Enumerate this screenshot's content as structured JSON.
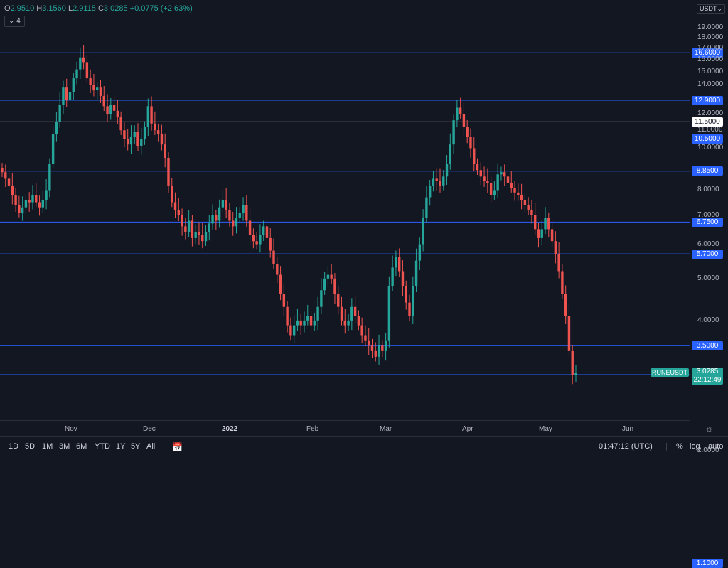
{
  "header": {
    "ohlc_o_label": "O",
    "ohlc_o": "2.9510",
    "ohlc_h_label": "H",
    "ohlc_h": "3.1560",
    "ohlc_l_label": "L",
    "ohlc_l": "2.9115",
    "ohlc_c_label": "C",
    "ohlc_c": "3.0285",
    "ohlc_change": "+0.0775 (+2.63%)",
    "indicator_count": "4",
    "currency": "USDT"
  },
  "price_axis": {
    "ticks": [
      "19.0000",
      "18.0000",
      "17.0000",
      "16.0000",
      "15.0000",
      "14.0000",
      "12.0000",
      "11.0000",
      "10.0000",
      "8.0000",
      "7.0000",
      "6.0000",
      "5.0000",
      "4.0000",
      "2.0000"
    ]
  },
  "levels": [
    {
      "label": "16.6000",
      "value": 16.6
    },
    {
      "label": "12.9000",
      "value": 12.9
    },
    {
      "label": "11.5000",
      "value": 11.5,
      "white": true
    },
    {
      "label": "10.5000",
      "value": 10.5
    },
    {
      "label": "8.8500",
      "value": 8.85
    },
    {
      "label": "6.7500",
      "value": 6.75
    },
    {
      "label": "5.7000",
      "value": 5.7
    },
    {
      "label": "3.5000",
      "value": 3.5
    },
    {
      "label": "3.0000",
      "value": 3.0
    },
    {
      "label": "1.1000",
      "value": 1.1
    }
  ],
  "current": {
    "symbol": "RUNEUSDT",
    "price": "3.0285",
    "countdown": "22:12:49",
    "value": 3.0285
  },
  "time_axis": {
    "labels": [
      "Nov",
      "Dec",
      "2022",
      "Feb",
      "Mar",
      "Apr",
      "May",
      "Jun"
    ]
  },
  "toolbar": {
    "timeframes": [
      "1D",
      "5D",
      "1M",
      "3M",
      "6M",
      "YTD",
      "1Y",
      "5Y",
      "All"
    ],
    "clock": "01:47:12 (UTC)",
    "percent": "%",
    "log": "log",
    "auto": "auto"
  },
  "colors": {
    "up": "#26a69a",
    "down": "#ef5350",
    "level": "#2962ff",
    "label_bg": "#2962ff"
  },
  "chart_data": {
    "type": "candlestick",
    "title": "",
    "ylim": [
      1,
      19
    ],
    "log_scale": true,
    "close_path": [
      8.8,
      8.5,
      8.2,
      7.8,
      7.4,
      7.1,
      7.3,
      7.6,
      7.5,
      7.8,
      7.5,
      7.3,
      7.6,
      8.0,
      9.2,
      10.8,
      11.5,
      12.6,
      13.8,
      12.9,
      13.5,
      14.5,
      15.2,
      16.2,
      15.8,
      14.5,
      14.0,
      13.6,
      13.8,
      13.2,
      12.5,
      12.0,
      12.6,
      12.2,
      11.8,
      11.0,
      10.5,
      10.2,
      10.6,
      10.9,
      10.1,
      10.5,
      11.2,
      12.5,
      11.4,
      11.0,
      10.8,
      10.2,
      9.5,
      8.2,
      7.5,
      7.2,
      7.0,
      6.6,
      6.4,
      6.8,
      6.2,
      6.4,
      6.3,
      6.1,
      6.4,
      6.7,
      7.0,
      6.8,
      7.3,
      7.6,
      7.2,
      6.8,
      6.6,
      6.9,
      7.1,
      7.4,
      6.8,
      6.3,
      6.1,
      6.0,
      6.3,
      6.6,
      6.2,
      5.8,
      5.4,
      5.1,
      4.6,
      4.3,
      3.9,
      3.7,
      3.9,
      4.0,
      3.9,
      4.0,
      4.1,
      3.9,
      4.0,
      4.3,
      4.7,
      5.0,
      5.1,
      5.0,
      4.6,
      4.3,
      4.0,
      3.9,
      4.0,
      4.3,
      4.1,
      3.9,
      3.7,
      3.6,
      3.5,
      3.4,
      3.3,
      3.5,
      3.4,
      3.6,
      4.8,
      5.3,
      5.6,
      5.2,
      4.8,
      4.4,
      4.1,
      4.8,
      5.5,
      6.0,
      6.9,
      7.7,
      8.2,
      8.5,
      8.4,
      8.2,
      8.6,
      9.2,
      10.2,
      11.6,
      12.4,
      12.0,
      11.2,
      10.6,
      10.0,
      9.2,
      8.9,
      8.6,
      8.4,
      8.3,
      7.8,
      8.0,
      8.7,
      8.8,
      8.6,
      8.3,
      8.1,
      7.9,
      7.8,
      7.6,
      7.4,
      7.2,
      7.0,
      6.5,
      6.2,
      6.5,
      6.9,
      6.5,
      6.1,
      5.7,
      5.2,
      4.6,
      4.1,
      3.4,
      3.0,
      3.03
    ]
  }
}
